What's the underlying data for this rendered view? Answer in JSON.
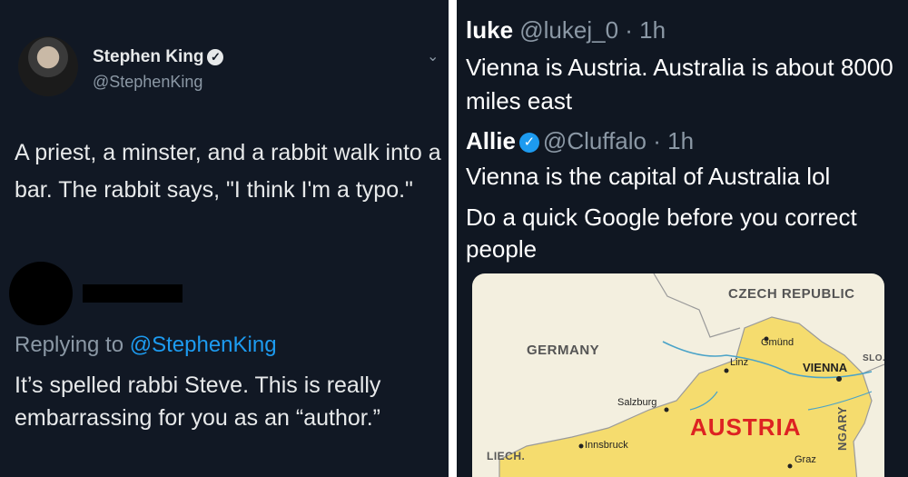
{
  "left_tweet": {
    "author_name": "Stephen King",
    "author_handle": "@StephenKing",
    "verified_glyph": "✓",
    "menu_caret": "⌄",
    "text": "A priest, a minster, and a rabbit walk into a bar. The rabbit says, \"I think I'm a typo.\"",
    "reply": {
      "replying_prefix": "Replying to ",
      "replying_mention": "@StephenKing",
      "text": "It’s spelled rabbi Steve. This is really embarrassing for you as an “author.”"
    }
  },
  "right_thread": {
    "tweet1": {
      "name": "luke",
      "handle": "@lukej_0",
      "time": " · 1h",
      "text": "Vienna is Austria. Australia is about 8000 miles east"
    },
    "tweet2": {
      "name": "Allie",
      "handle": "@Cluffalo",
      "time": " · 1h",
      "verified_glyph": "✓",
      "text_line1": "Vienna is the capital of Australia lol",
      "text_line2": "Do a quick Google before you correct people"
    },
    "map": {
      "labels": {
        "czech": "CZECH REPUBLIC",
        "germany": "GERMANY",
        "austria": "AUSTRIA",
        "slo": "SLO.",
        "liech": "LIECH.",
        "hungary": "NGARY"
      },
      "cities": {
        "gmund": "Gmünd",
        "linz": "Linz",
        "vienna": "VIENNA",
        "salzburg": "Salzburg",
        "innsbruck": "Innsbruck",
        "graz": "Graz"
      },
      "colors": {
        "austria_fill": "#f5dc6e",
        "neighbor_fill": "#f3efdf",
        "river": "#4aa3c8",
        "border": "#9a9a9a",
        "austria_label": "#dd2222"
      }
    }
  }
}
